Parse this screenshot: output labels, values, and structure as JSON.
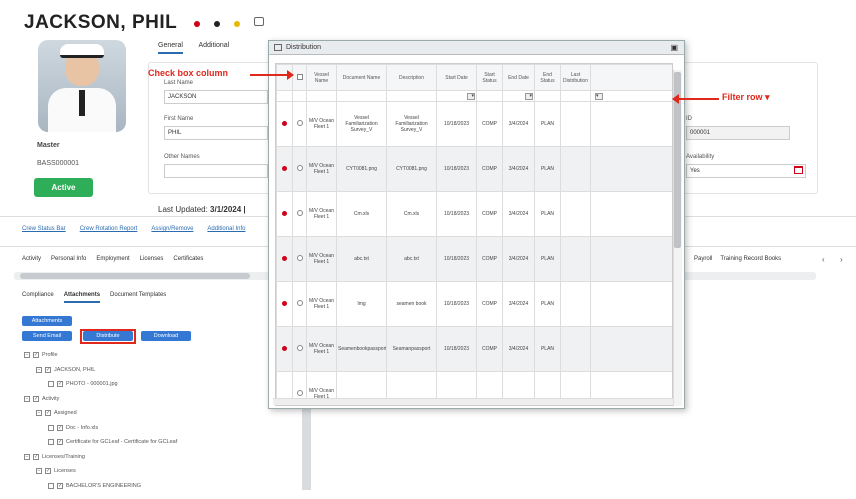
{
  "profile": {
    "name": "JACKSON, PHIL",
    "role": "Master",
    "id": "BASS000001",
    "status": "Active",
    "last_updated_label": "Last Updated:",
    "last_updated_value": "3/1/2024 |"
  },
  "header_icons": [
    "red-dot-icon",
    "black-dot-icon",
    "yellow-dot-icon",
    "comment-icon"
  ],
  "profile_tabs": {
    "general": "General",
    "additional": "Additional"
  },
  "form": {
    "last_name_label": "Last Name",
    "last_name_value": "JACKSON",
    "first_name_label": "First Name",
    "first_name_value": "PHIL",
    "other_names_label": "Other Names",
    "right_label_1": "ID",
    "right_value_1": "000001",
    "right_label_2": "Availability",
    "right_value_2": "Yes"
  },
  "links": [
    "Crew Status Bar",
    "Crew Rotation Report",
    "Assign/Remove",
    "Additional Info"
  ],
  "nav_tabs_left": [
    "Activity",
    "Personal Info",
    "Employment",
    "Licenses",
    "Certificates"
  ],
  "nav_tabs_right": [
    "Payroll",
    "Training Record Books"
  ],
  "sub_tabs": [
    "Compliance",
    "Attachments",
    "Document Templates"
  ],
  "buttons": {
    "attachments": "Attachments",
    "send_email": "Send Email",
    "distribute": "Distribute",
    "download": "Download"
  },
  "tree": [
    {
      "indent": 0,
      "label": "Profile"
    },
    {
      "indent": 1,
      "label": "JACKSON, PHIL"
    },
    {
      "indent": 2,
      "label": "PHOTO - 000001.jpg"
    },
    {
      "indent": 0,
      "label": "Activity"
    },
    {
      "indent": 1,
      "label": "Assigned"
    },
    {
      "indent": 2,
      "label": "Doc - Info.xls"
    },
    {
      "indent": 2,
      "label": "Certificate for GCLeaf - Certificate for GCLeaf"
    },
    {
      "indent": 0,
      "label": "Licenses/Training"
    },
    {
      "indent": 1,
      "label": "Licenses"
    },
    {
      "indent": 2,
      "label": "BACHELOR'S ENGINEERING"
    }
  ],
  "dialog": {
    "title": "Distribution",
    "columns": [
      "Vessel Name",
      "Document Name",
      "Description",
      "Start Date",
      "Start Status",
      "End Date",
      "End Status",
      "Last Distribution"
    ],
    "rows": [
      {
        "vessel": "M/V Ocean Fleet 1",
        "doc": "Vessel Familiarization Survey_V",
        "desc": "Vessel Familiarization Survey_V",
        "start": "10/18/2023",
        "sstatus": "COMP",
        "end": "3/4/2024",
        "estatus": "PLAN"
      },
      {
        "vessel": "M/V Ocean Fleet 1",
        "doc": "CYT0081.png",
        "desc": "CYT0081.png",
        "start": "10/18/2023",
        "sstatus": "COMP",
        "end": "3/4/2024",
        "estatus": "PLAN"
      },
      {
        "vessel": "M/V Ocean Fleet 1",
        "doc": "Cm.xls",
        "desc": "Cm.xls",
        "start": "10/18/2023",
        "sstatus": "COMP",
        "end": "3/4/2024",
        "estatus": "PLAN"
      },
      {
        "vessel": "M/V Ocean Fleet 1",
        "doc": "abc.txt",
        "desc": "abc.txt",
        "start": "10/18/2023",
        "sstatus": "COMP",
        "end": "3/4/2024",
        "estatus": "PLAN"
      },
      {
        "vessel": "M/V Ocean Fleet 1",
        "doc": "Img",
        "desc": "seamen book",
        "start": "10/18/2023",
        "sstatus": "COMP",
        "end": "3/4/2024",
        "estatus": "PLAN"
      },
      {
        "vessel": "M/V Ocean Fleet 1",
        "doc": "Seamenbookpassport",
        "desc": "Seamanpassport",
        "start": "10/18/2023",
        "sstatus": "COMP",
        "end": "3/4/2024",
        "estatus": "PLAN"
      },
      {
        "vessel": "M/V Ocean Fleet 1",
        "doc": "",
        "desc": "",
        "start": "",
        "sstatus": "",
        "end": "",
        "estatus": ""
      }
    ]
  },
  "annotations": {
    "checkbox": "Check box column",
    "filter": "Filter row"
  },
  "colors": {
    "accent": "#2b6cb0",
    "active": "#2fae5a",
    "annotation": "#e0281c"
  }
}
